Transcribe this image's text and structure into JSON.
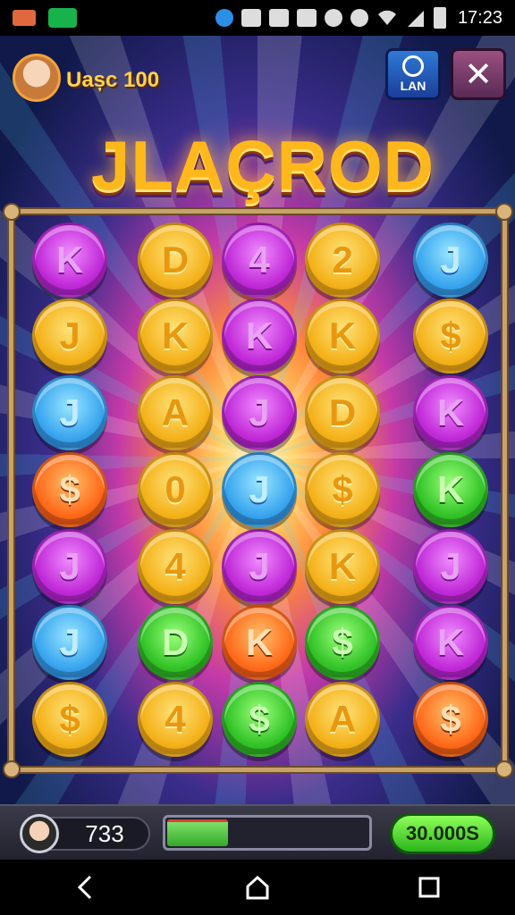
{
  "status_bar": {
    "time": "17:23",
    "icons": [
      "crown-icon",
      "money-icon",
      "app-icon",
      "scan-icon",
      "box-icon",
      "n-icon",
      "circle-icon",
      "gear-icon",
      "wifi-icon",
      "signal-icon",
      "battery-icon"
    ]
  },
  "header": {
    "player_label": "Uașc 100",
    "lan_button_label": "LAN",
    "close_button_label": "✕"
  },
  "title": "JLAÇROD",
  "board": {
    "rows": [
      [
        {
          "symbol": "K",
          "color": "purple"
        },
        {
          "symbol": "D",
          "color": "gold"
        },
        {
          "symbol": "4",
          "color": "purple"
        },
        {
          "symbol": "2",
          "color": "gold"
        },
        {
          "symbol": "J",
          "color": "blue"
        }
      ],
      [
        {
          "symbol": "J",
          "color": "gold"
        },
        {
          "symbol": "K",
          "color": "gold"
        },
        {
          "symbol": "K",
          "color": "purple"
        },
        {
          "symbol": "K",
          "color": "gold"
        },
        {
          "symbol": "$",
          "color": "gold"
        }
      ],
      [
        {
          "symbol": "J",
          "color": "blue"
        },
        {
          "symbol": "A",
          "color": "gold"
        },
        {
          "symbol": "J",
          "color": "purple"
        },
        {
          "symbol": "D",
          "color": "gold"
        },
        {
          "symbol": "K",
          "color": "purple"
        }
      ],
      [
        {
          "symbol": "$",
          "color": "orange"
        },
        {
          "symbol": "0",
          "color": "gold"
        },
        {
          "symbol": "J",
          "color": "blue"
        },
        {
          "symbol": "$",
          "color": "gold"
        },
        {
          "symbol": "K",
          "color": "green"
        }
      ],
      [
        {
          "symbol": "J",
          "color": "purple"
        },
        {
          "symbol": "4",
          "color": "gold"
        },
        {
          "symbol": "J",
          "color": "purple"
        },
        {
          "symbol": "K",
          "color": "gold"
        },
        {
          "symbol": "J",
          "color": "purple"
        }
      ],
      [
        {
          "symbol": "J",
          "color": "blue"
        },
        {
          "symbol": "D",
          "color": "green"
        },
        {
          "symbol": "K",
          "color": "orange"
        },
        {
          "symbol": "$",
          "color": "green"
        },
        {
          "symbol": "K",
          "color": "purple"
        }
      ],
      [
        {
          "symbol": "$",
          "color": "gold"
        },
        {
          "symbol": "4",
          "color": "gold"
        },
        {
          "symbol": "$",
          "color": "green"
        },
        {
          "symbol": "A",
          "color": "gold"
        },
        {
          "symbol": "$",
          "color": "orange"
        }
      ]
    ]
  },
  "hud": {
    "score": "733",
    "progress_fraction": 0.3,
    "credit_button_label": "30.000S"
  },
  "nav": {
    "back": "back-icon",
    "home": "home-icon",
    "recents": "recents-icon"
  }
}
